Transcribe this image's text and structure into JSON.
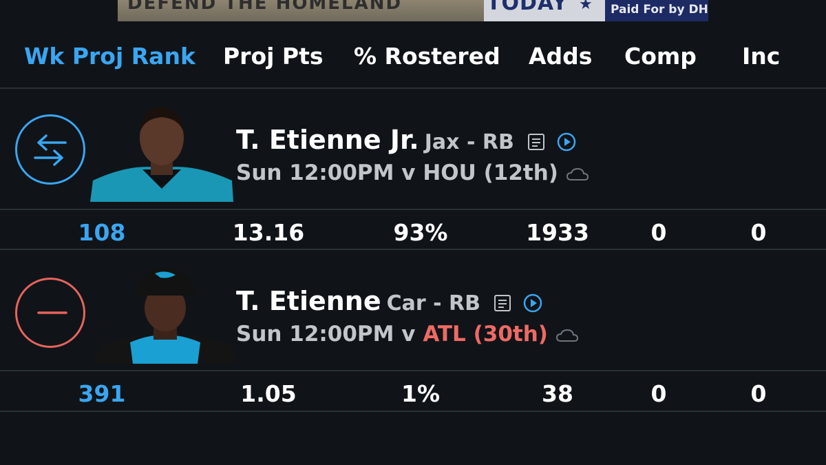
{
  "ad": {
    "left_text": "DEFEND THE HOMELAND",
    "mid_text": "TODAY",
    "right_text": "Paid For by DHS"
  },
  "headers": [
    "Wk Proj Rank",
    "Proj Pts",
    "% Rostered",
    "Adds",
    "Comp",
    "Inc"
  ],
  "players": [
    {
      "name": "T. Etienne Jr.",
      "team_pos": "Jax - RB",
      "game": "Sun 12:00PM v",
      "opponent": "HOU (12th)",
      "action": "swap",
      "stats": [
        "108",
        "13.16",
        "93%",
        "1933",
        "0",
        "0"
      ]
    },
    {
      "name": "T. Etienne",
      "team_pos": "Car - RB",
      "game": "Sun 12:00PM v",
      "opponent": "ATL (30th)",
      "action": "drop",
      "stats": [
        "391",
        "1.05",
        "1%",
        "38",
        "0",
        "0"
      ]
    }
  ],
  "colors": {
    "accent": "#3aa6f2",
    "danger": "#e8645c",
    "background": "#101418"
  }
}
